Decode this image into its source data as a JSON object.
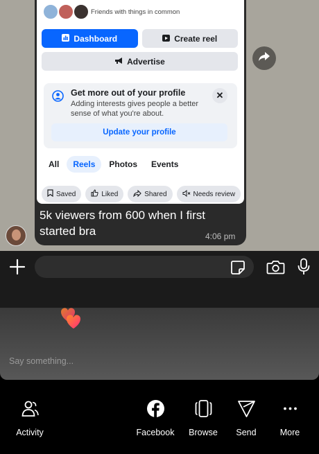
{
  "shared_screenshot": {
    "friends_caption": "Friends with things in common",
    "buttons": {
      "dashboard": "Dashboard",
      "create_reel": "Create reel",
      "advertise": "Advertise"
    },
    "profile_card": {
      "title": "Get more out of your profile",
      "subtitle": "Adding interests gives people a better sense of what you're about.",
      "close_symbol": "✕",
      "update_button": "Update your profile"
    },
    "tabs": [
      {
        "label": "All",
        "active": false
      },
      {
        "label": "Reels",
        "active": true
      },
      {
        "label": "Photos",
        "active": false
      },
      {
        "label": "Events",
        "active": false
      }
    ],
    "filters": [
      {
        "label": "Saved",
        "icon": "bookmark-icon"
      },
      {
        "label": "Liked",
        "icon": "thumbs-up-icon"
      },
      {
        "label": "Shared",
        "icon": "share-icon"
      },
      {
        "label": "Needs review",
        "icon": "muted-speaker-icon"
      }
    ]
  },
  "message": {
    "text": "5k viewers from 600 when I first started bra",
    "time": "4:06 pm"
  },
  "composer": {
    "input_value": ""
  },
  "live": {
    "say_placeholder": "Say something..."
  },
  "bottom_nav": [
    {
      "label": "Activity",
      "icon": "activity-people-icon"
    },
    {
      "label": "Facebook",
      "icon": "facebook-icon"
    },
    {
      "label": "Browse",
      "icon": "browse-cards-icon"
    },
    {
      "label": "Send",
      "icon": "send-icon"
    },
    {
      "label": "More",
      "icon": "more-dots-icon"
    }
  ],
  "colors": {
    "facebook_blue": "#0866ff",
    "chat_wallpaper": "#a8a59c",
    "bubble": "#2a2a2a",
    "heart_gradient": [
      "#ff4d8d",
      "#ff8a2a"
    ]
  }
}
